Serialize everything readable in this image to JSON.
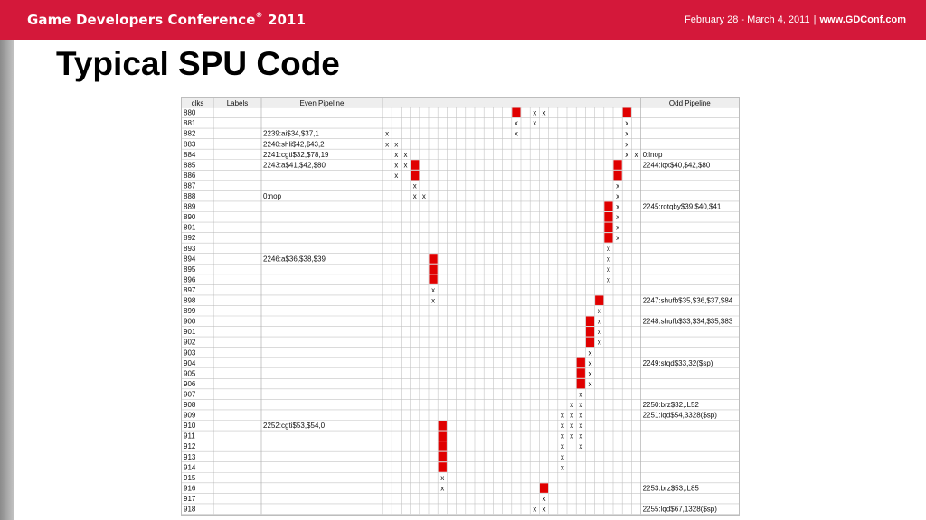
{
  "header": {
    "conference": "Game Developers Conference",
    "trademark": "®",
    "year": "2011",
    "dates": "February 28 - March 4, 2011",
    "separator": "|",
    "website": "www.GDConf.com",
    "accent_color": "#d4183a"
  },
  "slide": {
    "title": "Typical SPU Code"
  },
  "pipeline_table": {
    "headers": {
      "clks": "clks",
      "labels": "Labels",
      "even": "Even Pipeline",
      "odd": "Odd Pipeline"
    },
    "rows": [
      {
        "clk": "880",
        "label": "",
        "even": "",
        "odd": ""
      },
      {
        "clk": "881",
        "label": "",
        "even": "",
        "odd": ""
      },
      {
        "clk": "882",
        "label": "",
        "even": "2239:ai$34,$37,1",
        "odd": ""
      },
      {
        "clk": "883",
        "label": "",
        "even": "2240:shli$42,$43,2",
        "odd": ""
      },
      {
        "clk": "884",
        "label": "",
        "even": "2241:cgti$32,$78,19",
        "odd": "0:lnop"
      },
      {
        "clk": "885",
        "label": "",
        "even": "2243:a$41,$42,$80",
        "odd": "2244:lqx$40,$42,$80"
      },
      {
        "clk": "886",
        "label": "",
        "even": "",
        "odd": ""
      },
      {
        "clk": "887",
        "label": "",
        "even": "",
        "odd": ""
      },
      {
        "clk": "888",
        "label": "",
        "even": "0:nop",
        "odd": ""
      },
      {
        "clk": "889",
        "label": "",
        "even": "",
        "odd": "2245:rotqby$39,$40,$41"
      },
      {
        "clk": "890",
        "label": "",
        "even": "",
        "odd": ""
      },
      {
        "clk": "891",
        "label": "",
        "even": "",
        "odd": ""
      },
      {
        "clk": "892",
        "label": "",
        "even": "",
        "odd": ""
      },
      {
        "clk": "893",
        "label": "",
        "even": "",
        "odd": ""
      },
      {
        "clk": "894",
        "label": "",
        "even": "2246:a$36,$38,$39",
        "odd": ""
      },
      {
        "clk": "895",
        "label": "",
        "even": "",
        "odd": ""
      },
      {
        "clk": "896",
        "label": "",
        "even": "",
        "odd": ""
      },
      {
        "clk": "897",
        "label": "",
        "even": "",
        "odd": ""
      },
      {
        "clk": "898",
        "label": "",
        "even": "",
        "odd": "2247:shufb$35,$36,$37,$84"
      },
      {
        "clk": "899",
        "label": "",
        "even": "",
        "odd": ""
      },
      {
        "clk": "900",
        "label": "",
        "even": "",
        "odd": "2248:shufb$33,$34,$35,$83"
      },
      {
        "clk": "901",
        "label": "",
        "even": "",
        "odd": ""
      },
      {
        "clk": "902",
        "label": "",
        "even": "",
        "odd": ""
      },
      {
        "clk": "903",
        "label": "",
        "even": "",
        "odd": ""
      },
      {
        "clk": "904",
        "label": "",
        "even": "",
        "odd": "2249:stqd$33,32($sp)"
      },
      {
        "clk": "905",
        "label": "",
        "even": "",
        "odd": ""
      },
      {
        "clk": "906",
        "label": "",
        "even": "",
        "odd": ""
      },
      {
        "clk": "907",
        "label": "",
        "even": "",
        "odd": ""
      },
      {
        "clk": "908",
        "label": "",
        "even": "",
        "odd": "2250:brz$32,.L52"
      },
      {
        "clk": "909",
        "label": "",
        "even": "",
        "odd": "2251:lqd$54,3328($sp)"
      },
      {
        "clk": "910",
        "label": "",
        "even": "2252:cgti$53,$54,0",
        "odd": ""
      },
      {
        "clk": "911",
        "label": "",
        "even": "",
        "odd": ""
      },
      {
        "clk": "912",
        "label": "",
        "even": "",
        "odd": ""
      },
      {
        "clk": "913",
        "label": "",
        "even": "",
        "odd": ""
      },
      {
        "clk": "914",
        "label": "",
        "even": "",
        "odd": ""
      },
      {
        "clk": "915",
        "label": "",
        "even": "",
        "odd": ""
      },
      {
        "clk": "916",
        "label": "",
        "even": "",
        "odd": "2253:brz$53,.L85"
      },
      {
        "clk": "917",
        "label": "",
        "even": "",
        "odd": ""
      },
      {
        "clk": "918",
        "label": "",
        "even": "",
        "odd": "2255:lqd$67,1328($sp)"
      }
    ],
    "register_columns": 28,
    "mark_symbol": "x",
    "busy_color": "#e00000",
    "red_cells": [
      [
        0,
        14
      ],
      [
        0,
        26
      ],
      [
        5,
        3
      ],
      [
        5,
        25
      ],
      [
        6,
        3
      ],
      [
        6,
        25
      ],
      [
        9,
        24
      ],
      [
        10,
        24
      ],
      [
        11,
        24
      ],
      [
        12,
        24
      ],
      [
        14,
        5
      ],
      [
        15,
        5
      ],
      [
        16,
        5
      ],
      [
        18,
        23
      ],
      [
        20,
        22
      ],
      [
        21,
        22
      ],
      [
        22,
        22
      ],
      [
        24,
        21
      ],
      [
        25,
        21
      ],
      [
        26,
        21
      ],
      [
        30,
        6
      ],
      [
        31,
        6
      ],
      [
        32,
        6
      ],
      [
        33,
        6
      ],
      [
        34,
        6
      ],
      [
        36,
        17
      ]
    ],
    "x_cells": [
      [
        0,
        16
      ],
      [
        0,
        17
      ],
      [
        1,
        14
      ],
      [
        1,
        16
      ],
      [
        1,
        26
      ],
      [
        2,
        0
      ],
      [
        2,
        14
      ],
      [
        2,
        26
      ],
      [
        3,
        0
      ],
      [
        3,
        1
      ],
      [
        3,
        26
      ],
      [
        4,
        1
      ],
      [
        4,
        2
      ],
      [
        4,
        26
      ],
      [
        4,
        27
      ],
      [
        5,
        1
      ],
      [
        5,
        2
      ],
      [
        6,
        1
      ],
      [
        7,
        3
      ],
      [
        7,
        25
      ],
      [
        8,
        3
      ],
      [
        8,
        4
      ],
      [
        8,
        25
      ],
      [
        9,
        25
      ],
      [
        10,
        25
      ],
      [
        11,
        25
      ],
      [
        12,
        25
      ],
      [
        13,
        24
      ],
      [
        14,
        24
      ],
      [
        15,
        24
      ],
      [
        16,
        24
      ],
      [
        17,
        5
      ],
      [
        18,
        5
      ],
      [
        19,
        23
      ],
      [
        20,
        23
      ],
      [
        21,
        23
      ],
      [
        22,
        23
      ],
      [
        23,
        22
      ],
      [
        24,
        22
      ],
      [
        25,
        22
      ],
      [
        26,
        22
      ],
      [
        27,
        21
      ],
      [
        28,
        20
      ],
      [
        28,
        21
      ],
      [
        29,
        19
      ],
      [
        29,
        20
      ],
      [
        29,
        21
      ],
      [
        30,
        19
      ],
      [
        30,
        20
      ],
      [
        30,
        21
      ],
      [
        31,
        19
      ],
      [
        31,
        20
      ],
      [
        31,
        21
      ],
      [
        32,
        19
      ],
      [
        32,
        21
      ],
      [
        33,
        19
      ],
      [
        34,
        19
      ],
      [
        35,
        6
      ],
      [
        36,
        6
      ],
      [
        37,
        17
      ],
      [
        38,
        16
      ],
      [
        38,
        17
      ]
    ]
  }
}
